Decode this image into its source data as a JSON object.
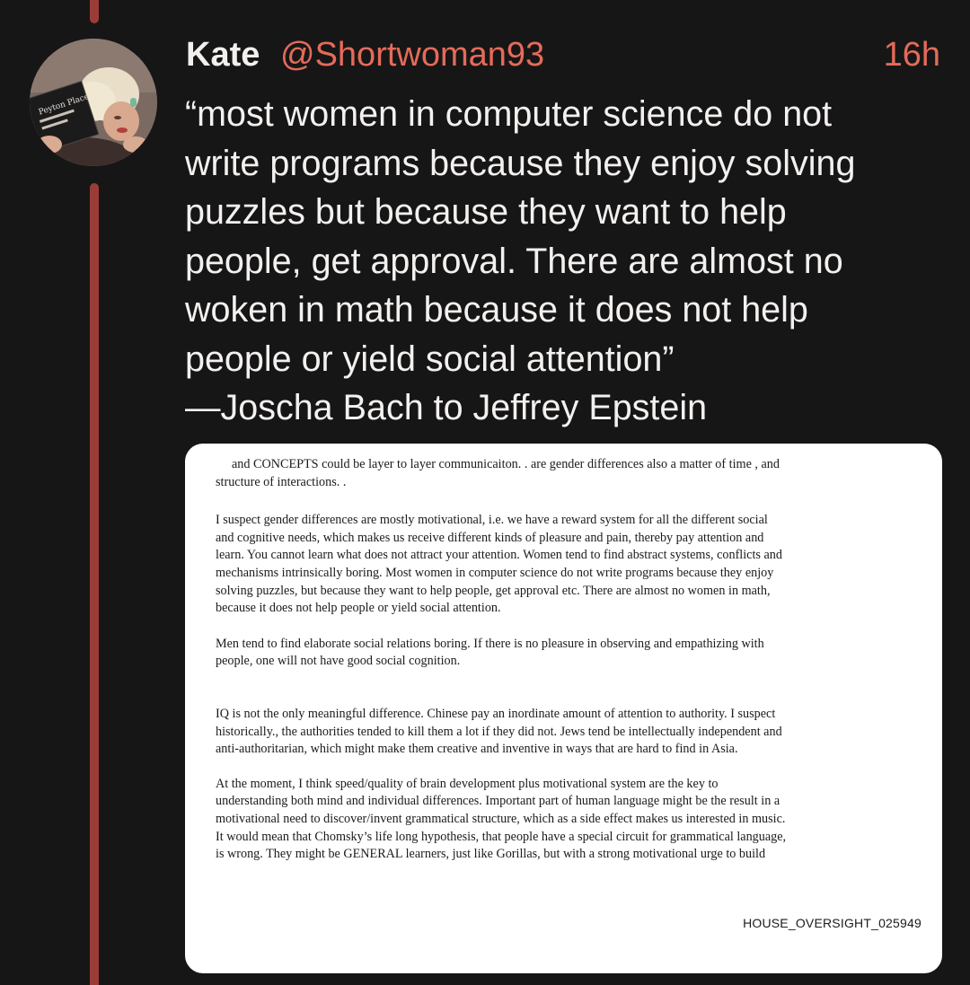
{
  "tweet": {
    "author_name": "Kate",
    "author_handle": "@Shortwoman93",
    "timestamp": "16h",
    "text_lines": [
      "“most women in computer science do not",
      "write programs because they enjoy solving",
      "puzzles but because they want to help",
      "people, get approval. There are almost no",
      "woken in math because it does not help",
      "people or yield social attention”",
      "—Joscha Bach to Jeffrey Epstein"
    ],
    "avatar_book_text": "Peyton Place"
  },
  "document": {
    "p1": [
      "and CONCEPTS  could be layer to layer communicaiton. . are gender differences also a matter of time , and",
      "structure of interactions. ."
    ],
    "p2": [
      "I suspect gender differences are mostly motivational, i.e. we have a reward system for all the different social",
      "and cognitive needs, which makes us receive different kinds of pleasure and pain, thereby pay attention and",
      "learn. You cannot learn what does not attract your attention. Women tend to find abstract systems, conflicts and",
      "mechanisms intrinsically boring. Most women in computer science do not write programs because they enjoy",
      "solving puzzles, but because they want to help people, get approval etc. There are almost no women in math,",
      "because it does not help people or yield social attention."
    ],
    "p3": [
      "Men tend to find elaborate social relations boring. If there is no pleasure in observing and empathizing with",
      "people, one will not have good social cognition."
    ],
    "p4": [
      "IQ is not the only meaningful difference. Chinese pay an inordinate amount of attention to authority. I suspect",
      "historically., the authorities tended to kill them a lot if they did not. Jews tend be intellectually independent and",
      "anti-authoritarian, which might make them creative and inventive in ways that are hard to find in Asia."
    ],
    "p5": [
      "At the moment, I think speed/quality of brain development plus motivational system are the key to",
      "understanding both mind and individual differences. Important part of human language might be the result in a",
      "motivational need to discover/invent grammatical structure, which as a side effect makes us interested in music.",
      "It would mean that Chomsky’s life long hypothesis, that people have a special circuit for grammatical language,",
      "is wrong. They might be GENERAL learners, just like Gorillas, but with a strong motivational urge to build"
    ],
    "bates_number": "HOUSE_OVERSIGHT_025949"
  },
  "colors": {
    "background": "#171616",
    "thread_line": "#9a3d38",
    "accent": "#e46b5a",
    "text": "#f3f1ef"
  }
}
